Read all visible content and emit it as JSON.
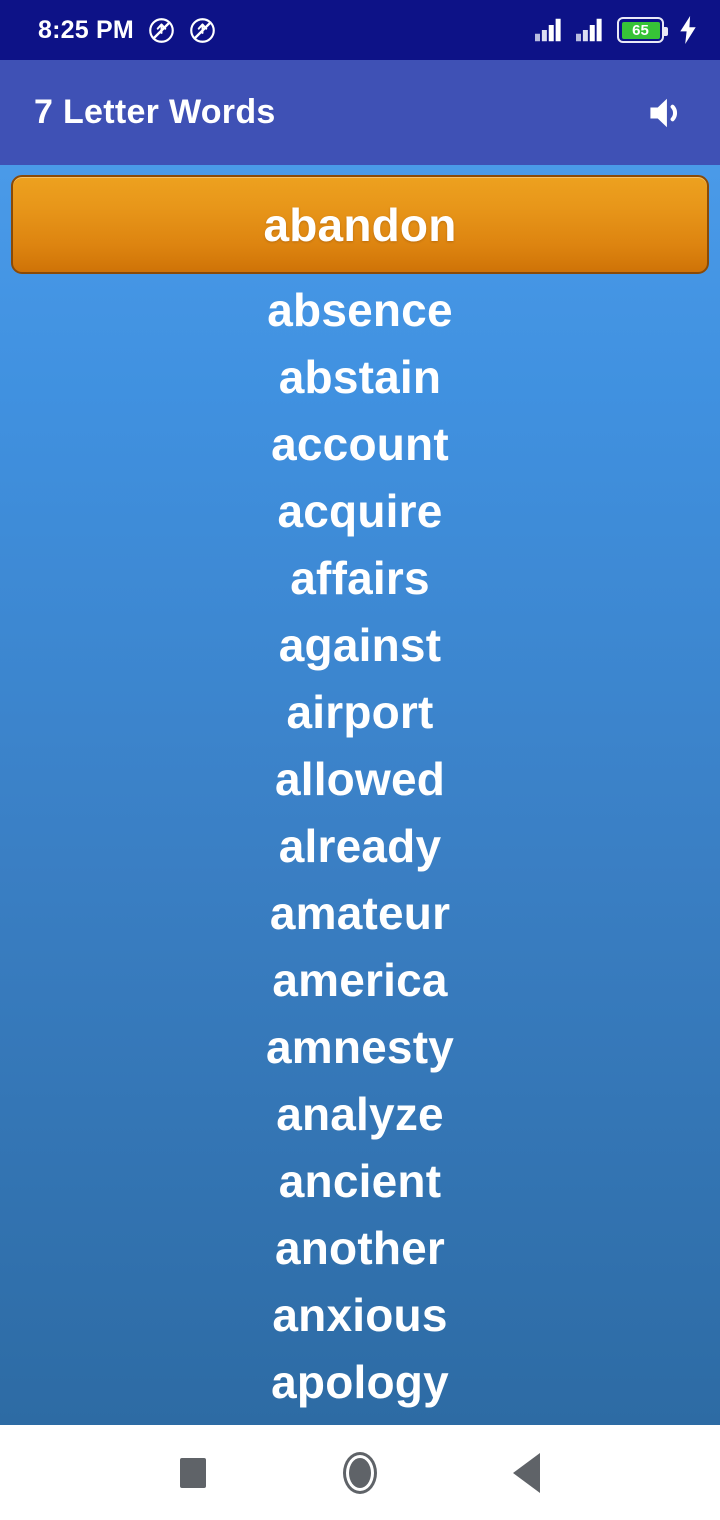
{
  "status_bar": {
    "time": "8:25 PM",
    "battery_percent": "65",
    "icons": [
      "silent-mode-icon",
      "silent-mode-icon",
      "signal-bars-icon",
      "signal-bars-icon",
      "battery-icon",
      "charging-bolt-icon"
    ],
    "background_color": "#0d1287"
  },
  "app_bar": {
    "title": "7 Letter Words",
    "volume_icon": "volume-speaker-icon",
    "background_color": "#3f51b5"
  },
  "word_list": {
    "selected_index": 0,
    "selected_color": "#e0900f",
    "background_top_color": "#4a9ae8",
    "background_bottom_color": "#2d6ba4",
    "words": [
      "abandon",
      "absence",
      "abstain",
      "account",
      "acquire",
      "affairs",
      "against",
      "airport",
      "allowed",
      "already",
      "amateur",
      "america",
      "amnesty",
      "analyze",
      "ancient",
      "another",
      "anxious",
      "apology"
    ]
  },
  "nav_bar": {
    "buttons": [
      {
        "name": "recents-button",
        "icon": "square-icon"
      },
      {
        "name": "home-button",
        "icon": "circle-icon"
      },
      {
        "name": "back-button",
        "icon": "triangle-left-icon"
      }
    ]
  }
}
